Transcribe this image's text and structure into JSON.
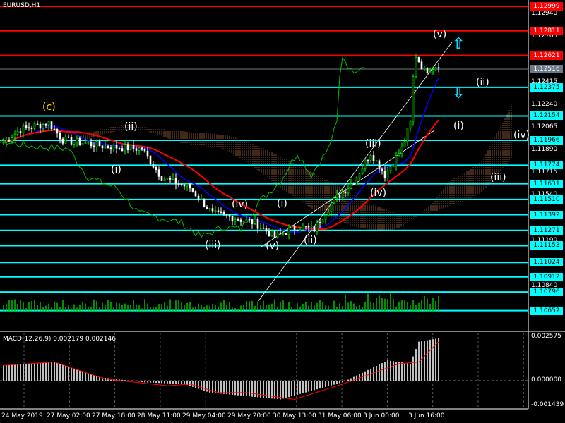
{
  "symbol_title": "EURUSD,H1",
  "macd_title": "MACD(12,26,9) 0.002179 0.002146",
  "colors": {
    "background": "#000000",
    "bull": "#00ff00",
    "bear": "#ffffff",
    "level_red": "#ff0000",
    "level_cyan": "#00ffff",
    "ma_red": "#ff0000",
    "ma_blue": "#0000ff",
    "chikou": "#00c000",
    "macd_hist": "#c0c0c0",
    "macd_signal": "#ff0000"
  },
  "price_axis": [
    "1.12940",
    "1.12765",
    "1.12590",
    "1.12415",
    "1.12240",
    "1.12065",
    "1.11890",
    "1.11715",
    "1.11540",
    "1.11365",
    "1.11190",
    "1.10840"
  ],
  "levels_red": [
    "1.12999",
    "1.12811",
    "1.12621"
  ],
  "current_price": "1.12516",
  "levels_cyan": [
    "1.12375",
    "1.12154",
    "1.11966",
    "1.11774",
    "1.11631",
    "1.11510",
    "1.11392",
    "1.11271",
    "1.11153",
    "1.11024",
    "1.10912",
    "1.10796",
    "1.10652"
  ],
  "macd_axis": [
    "0.002575",
    "0.000000",
    "-0.001439"
  ],
  "time_axis": [
    "24 May 2019",
    "27 May 02:00",
    "27 May 18:00",
    "28 May 11:00",
    "29 May 04:00",
    "29 May 20:00",
    "30 May 13:00",
    "31 May 06:00",
    "3 Jun 00:00",
    "3 Jun 16:00"
  ],
  "wave_labels": [
    "(c)",
    "(ii)",
    "(i)",
    "(iii)",
    "(iv)",
    "(v)",
    "(i)",
    "(ii)",
    "(iii)",
    "(iv)",
    "(v)",
    "(ii)",
    "(i)",
    "(iii)",
    "(iv)"
  ],
  "chart_data": {
    "type": "candlestick",
    "price_path": [
      [
        0,
        1.1195
      ],
      [
        6,
        1.1205
      ],
      [
        16,
        1.121
      ],
      [
        21,
        1.1197
      ],
      [
        36,
        1.1192
      ],
      [
        49,
        1.119
      ],
      [
        56,
        1.1168
      ],
      [
        66,
        1.116
      ],
      [
        74,
        1.114
      ],
      [
        81,
        1.1137
      ],
      [
        89,
        1.1133
      ],
      [
        96,
        1.1122
      ],
      [
        104,
        1.113
      ],
      [
        110,
        1.1128
      ],
      [
        116,
        1.1148
      ],
      [
        124,
        1.1165
      ],
      [
        130,
        1.1187
      ],
      [
        135,
        1.117
      ],
      [
        141,
        1.119
      ],
      [
        144,
        1.121
      ],
      [
        145,
        1.1245
      ],
      [
        146,
        1.1262
      ],
      [
        149,
        1.125
      ],
      [
        154,
        1.1255
      ]
    ],
    "macd_path": [
      [
        0,
        0.0009
      ],
      [
        18,
        0.0011
      ],
      [
        34,
        0.0002
      ],
      [
        50,
        -0.0001
      ],
      [
        64,
        -0.0002
      ],
      [
        73,
        -0.0007
      ],
      [
        98,
        -0.0011
      ],
      [
        120,
        -0.0001
      ],
      [
        136,
        0.0012
      ],
      [
        144,
        0.001
      ],
      [
        147,
        0.0023
      ],
      [
        154,
        0.0025
      ]
    ],
    "signal_path": [
      [
        0,
        0.0009
      ],
      [
        18,
        0.0011
      ],
      [
        36,
        0.0001
      ],
      [
        58,
        -0.0003
      ],
      [
        66,
        -0.0002
      ],
      [
        76,
        -0.0007
      ],
      [
        86,
        -0.0007
      ],
      [
        103,
        -0.0011
      ],
      [
        120,
        -0.0002
      ],
      [
        140,
        0.001
      ],
      [
        147,
        0.0011
      ],
      [
        154,
        0.0023
      ]
    ],
    "macd_range": [
      -0.001439,
      0.002575
    ],
    "price_range": [
      1.106,
      1.13
    ]
  }
}
